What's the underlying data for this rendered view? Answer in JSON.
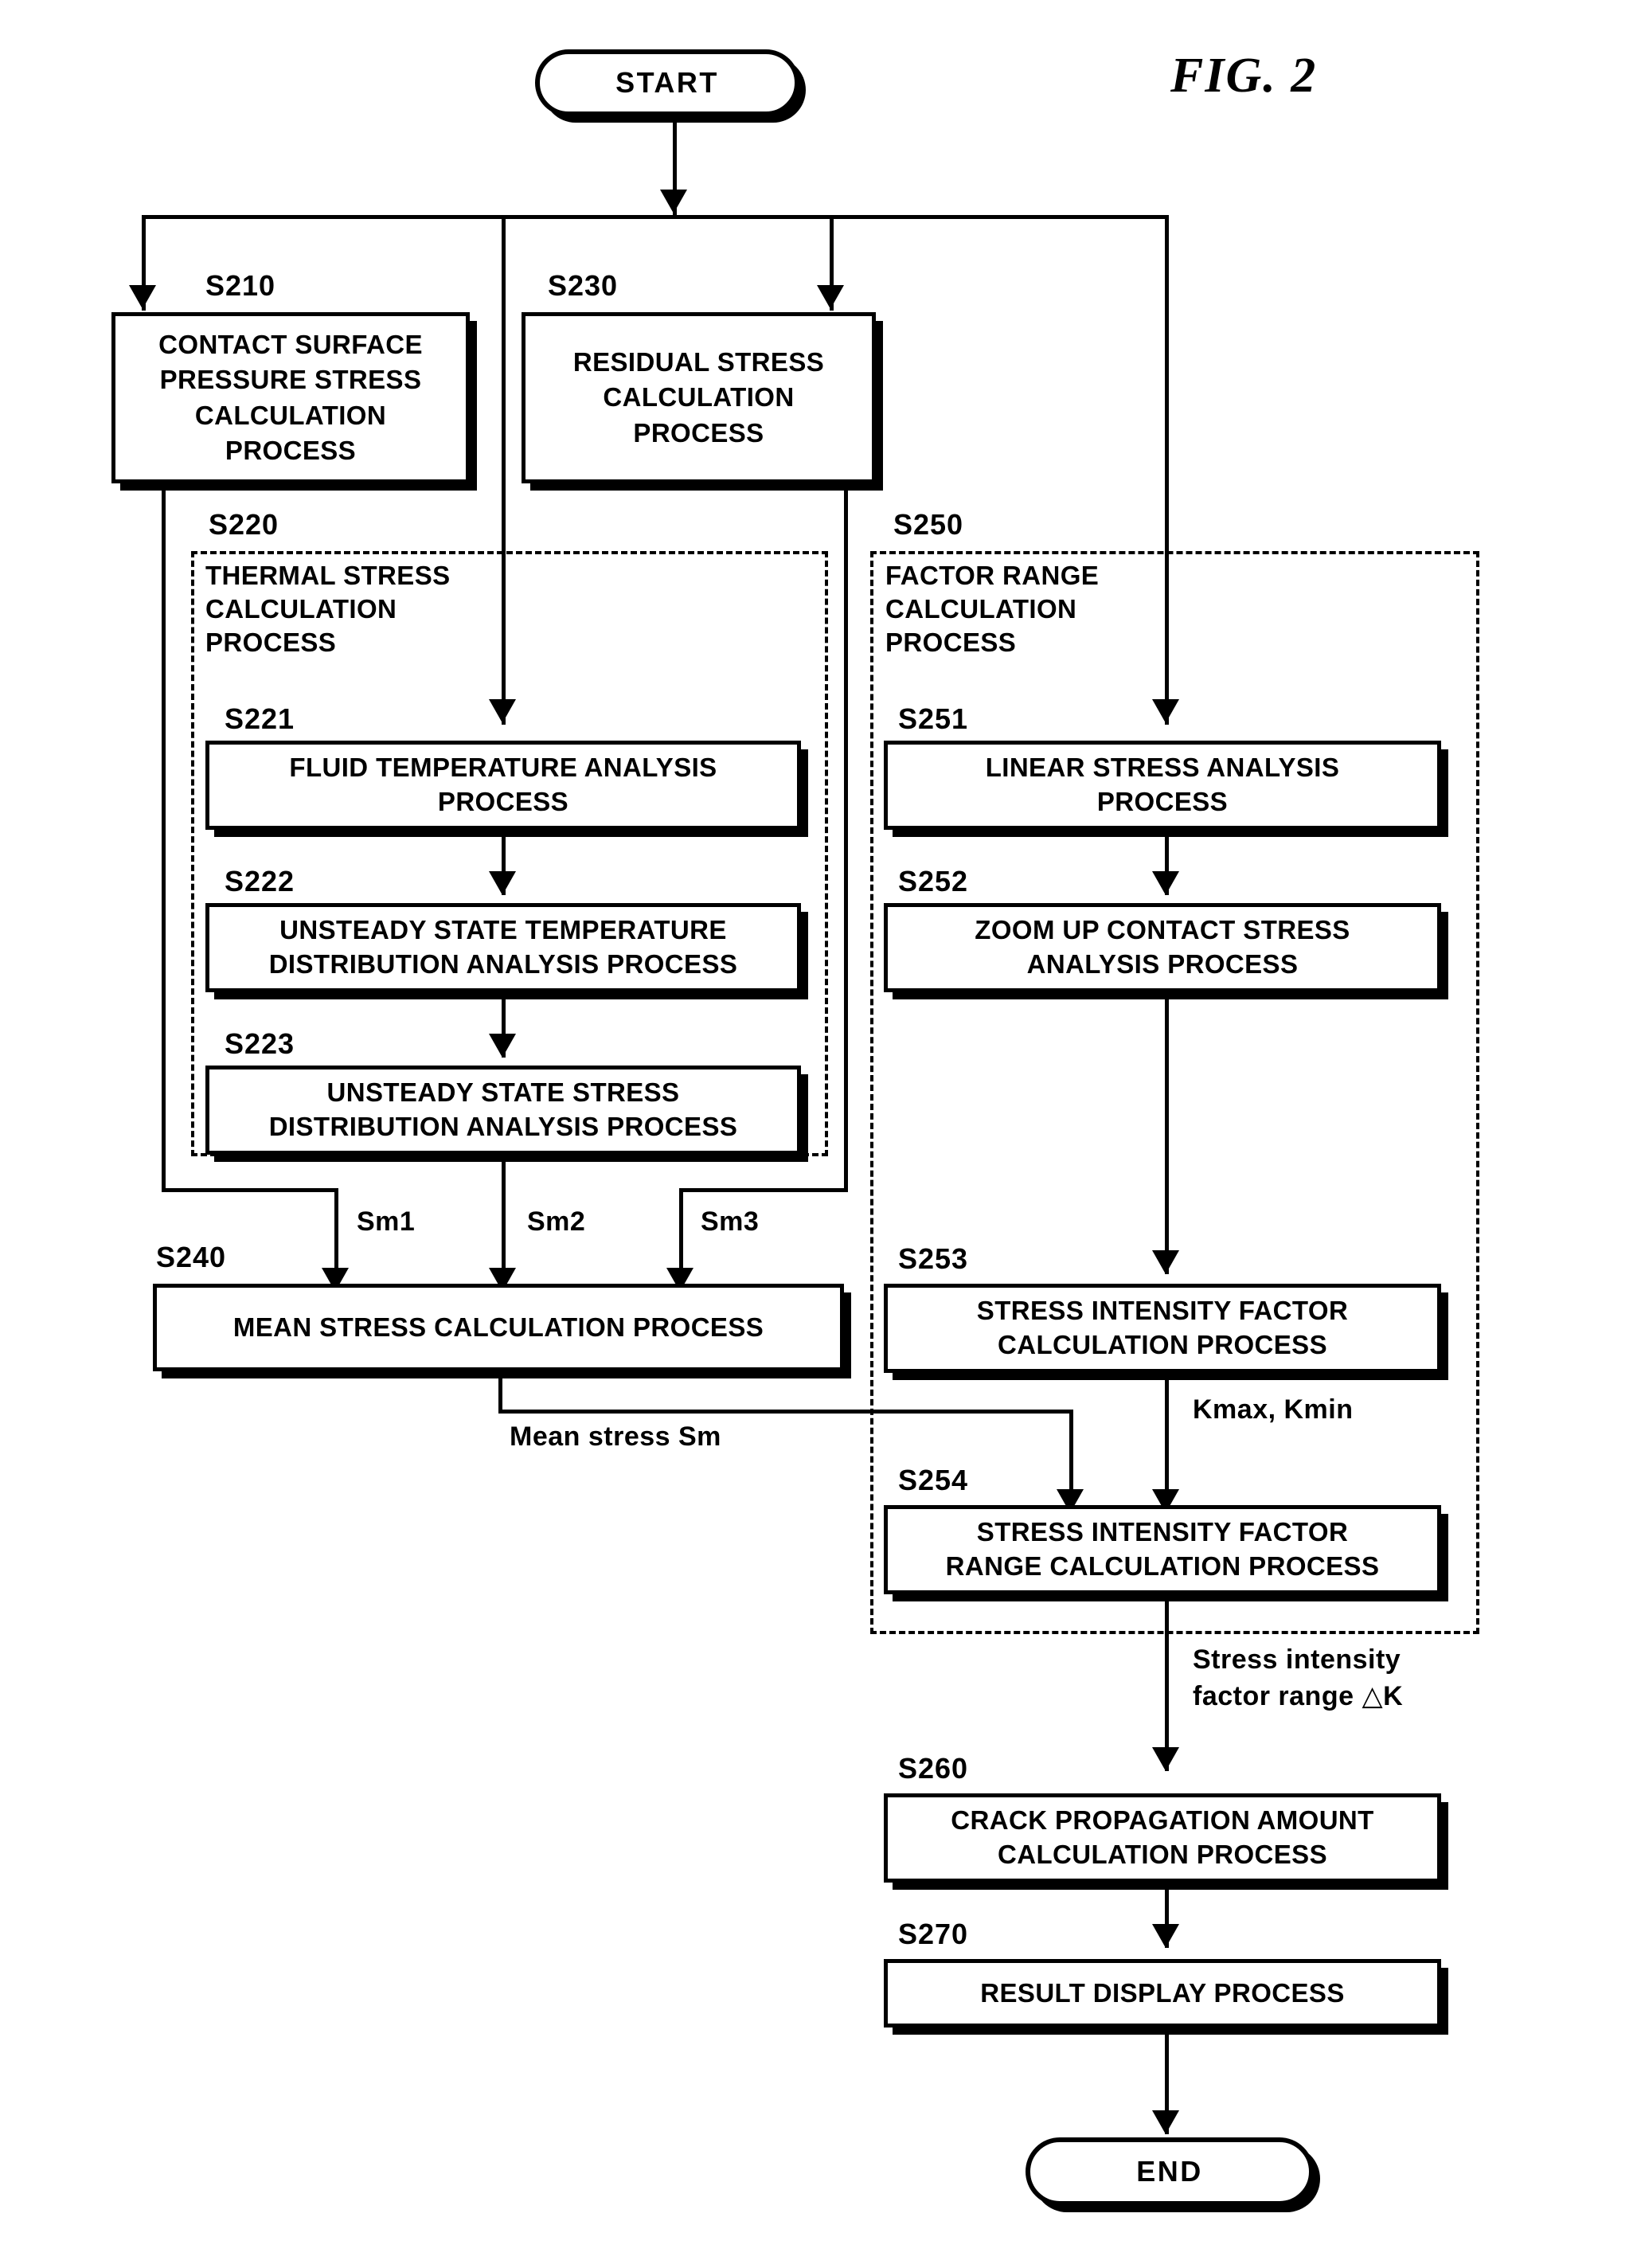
{
  "figure": {
    "title": "FIG. 2"
  },
  "terminators": {
    "start": "START",
    "end": "END"
  },
  "steps": {
    "s210": {
      "tag": "S210",
      "label": "CONTACT SURFACE\nPRESSURE STRESS\nCALCULATION\nPROCESS"
    },
    "s230": {
      "tag": "S230",
      "label": "RESIDUAL STRESS\nCALCULATION\nPROCESS"
    },
    "s220": {
      "tag": "S220",
      "label": "THERMAL STRESS\nCALCULATION\nPROCESS"
    },
    "s221": {
      "tag": "S221",
      "label": "FLUID TEMPERATURE ANALYSIS\nPROCESS"
    },
    "s222": {
      "tag": "S222",
      "label": "UNSTEADY STATE TEMPERATURE\nDISTRIBUTION ANALYSIS PROCESS"
    },
    "s223": {
      "tag": "S223",
      "label": "UNSTEADY STATE STRESS\nDISTRIBUTION ANALYSIS PROCESS"
    },
    "s240": {
      "tag": "S240",
      "label": "MEAN STRESS CALCULATION PROCESS"
    },
    "s250": {
      "tag": "S250",
      "label": "FACTOR RANGE\nCALCULATION\nPROCESS"
    },
    "s251": {
      "tag": "S251",
      "label": "LINEAR STRESS ANALYSIS\nPROCESS"
    },
    "s252": {
      "tag": "S252",
      "label": "ZOOM UP CONTACT STRESS\nANALYSIS PROCESS"
    },
    "s253": {
      "tag": "S253",
      "label": "STRESS INTENSITY FACTOR\nCALCULATION PROCESS"
    },
    "s254": {
      "tag": "S254",
      "label": "STRESS INTENSITY FACTOR\nRANGE CALCULATION PROCESS"
    },
    "s260": {
      "tag": "S260",
      "label": "CRACK PROPAGATION AMOUNT\nCALCULATION PROCESS"
    },
    "s270": {
      "tag": "S270",
      "label": "RESULT DISPLAY PROCESS"
    }
  },
  "edge_labels": {
    "sm1": "Sm1",
    "sm2": "Sm2",
    "sm3": "Sm3",
    "mean_stress": "Mean stress Sm",
    "kmax_kmin": "Kmax, Kmin",
    "delta_k": "Stress intensity\nfactor range  △K"
  },
  "colors": {
    "ink": "#000000",
    "paper": "#ffffff"
  }
}
